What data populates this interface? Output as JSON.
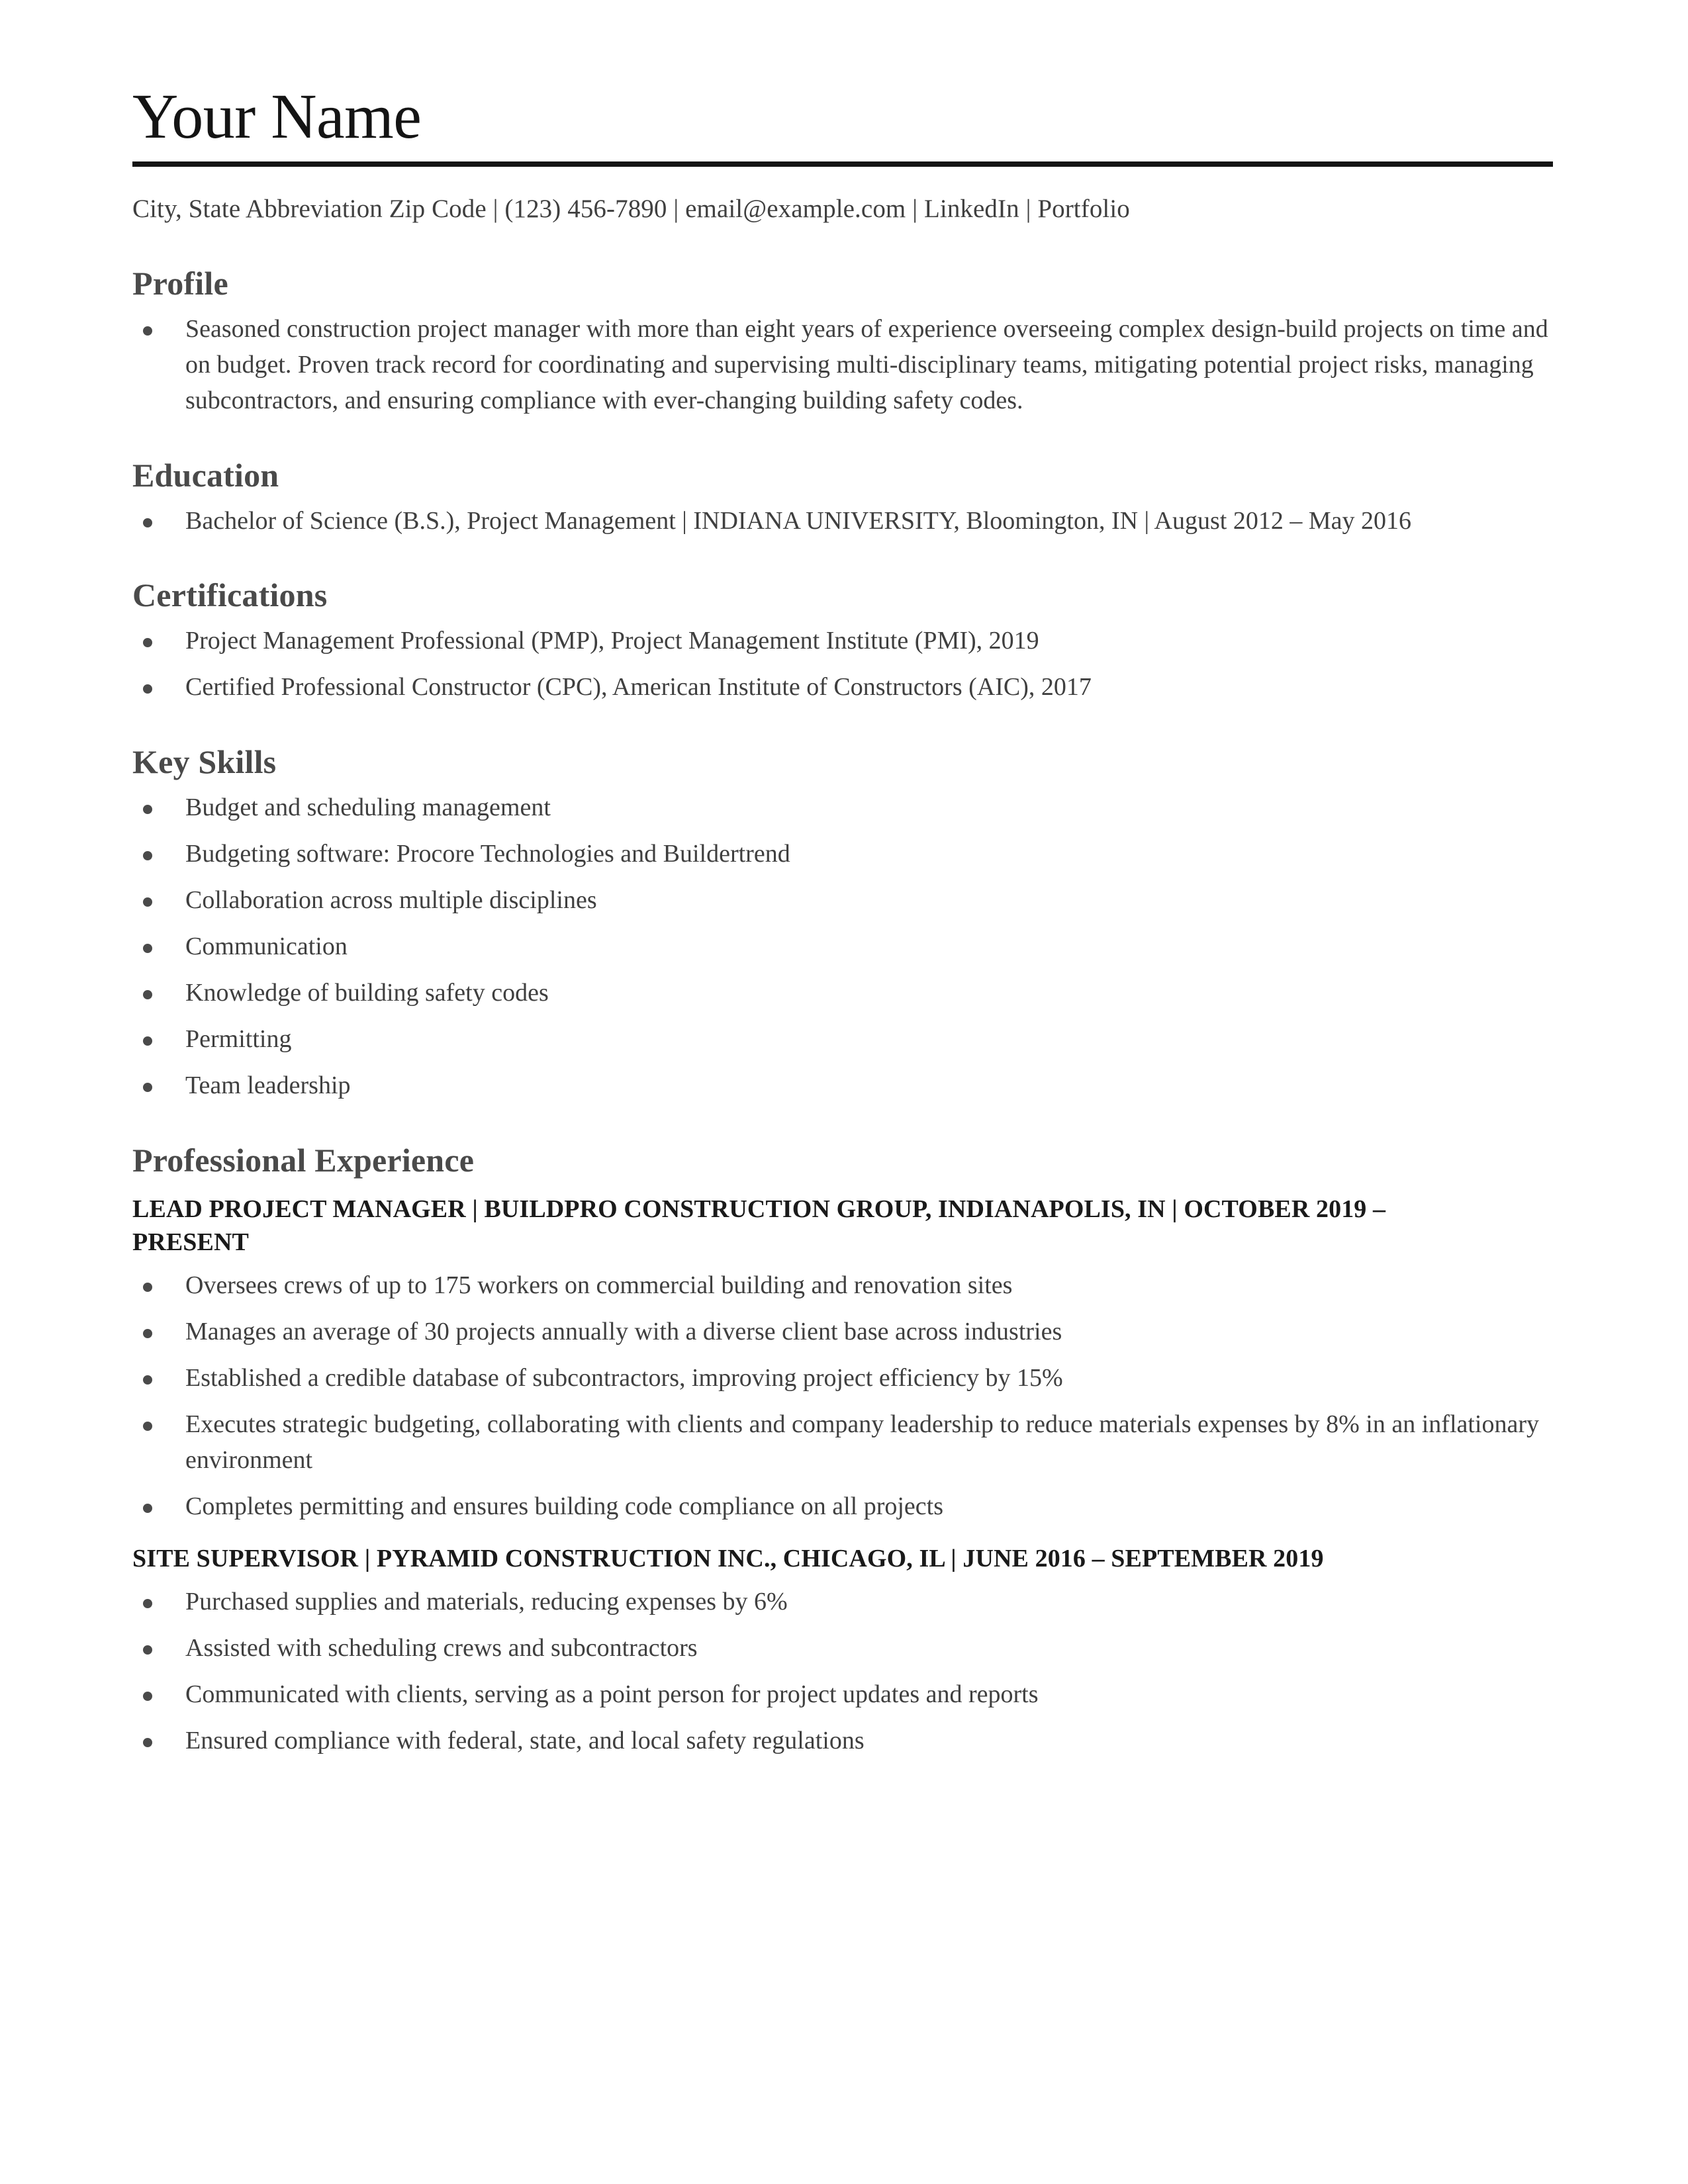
{
  "header": {
    "name": "Your Name",
    "contact": "City, State Abbreviation Zip Code | (123) 456-7890 | email@example.com | LinkedIn | Portfolio"
  },
  "colors": {
    "heading_gray": "#4a4a4a",
    "body_gray": "#3f3f3f",
    "title_black": "#1a1a1a",
    "rule": "#141414"
  },
  "profile": {
    "heading": "Profile",
    "bullets": [
      "Seasoned construction project manager with more than eight years of experience overseeing complex design-build projects on time and on budget. Proven track record for coordinating and supervising multi-disciplinary teams, mitigating potential project risks, managing subcontractors, and ensuring compliance with ever-changing building safety codes."
    ]
  },
  "education": {
    "heading": "Education",
    "bullets": [
      "Bachelor of Science (B.S.), Project Management | INDIANA UNIVERSITY, Bloomington, IN | August 2012 – May 2016"
    ]
  },
  "certifications": {
    "heading": "Certifications",
    "bullets": [
      "Project Management Professional (PMP), Project Management Institute (PMI), 2019",
      "Certified Professional Constructor (CPC), American Institute of Constructors (AIC), 2017"
    ]
  },
  "key_skills": {
    "heading": "Key Skills",
    "bullets": [
      "Budget and scheduling management",
      "Budgeting software: Procore Technologies and Buildertrend",
      "Collaboration across multiple disciplines",
      "Communication",
      "Knowledge of building safety codes",
      "Permitting",
      "Team leadership"
    ]
  },
  "experience": {
    "heading": "Professional Experience",
    "jobs": [
      {
        "title": "LEAD PROJECT MANAGER | BUILDPRO CONSTRUCTION GROUP, INDIANAPOLIS, IN | OCTOBER 2019 – PRESENT",
        "bullets": [
          "Oversees crews of up to 175 workers on commercial building and renovation sites",
          "Manages an average of 30 projects annually with a diverse client base across industries",
          "Established a credible database of subcontractors, improving project efficiency by 15%",
          "Executes strategic budgeting, collaborating with clients and company leadership to reduce materials expenses by 8% in an inflationary environment",
          "Completes permitting and ensures building code compliance on all projects"
        ]
      },
      {
        "title": "SITE SUPERVISOR | PYRAMID CONSTRUCTION INC., CHICAGO, IL | JUNE 2016 – SEPTEMBER 2019",
        "bullets": [
          "Purchased supplies and materials, reducing expenses by 6%",
          "Assisted with scheduling crews and subcontractors",
          "Communicated with clients, serving as a point person for project updates and reports",
          "Ensured compliance with federal, state, and local safety regulations"
        ]
      }
    ]
  }
}
